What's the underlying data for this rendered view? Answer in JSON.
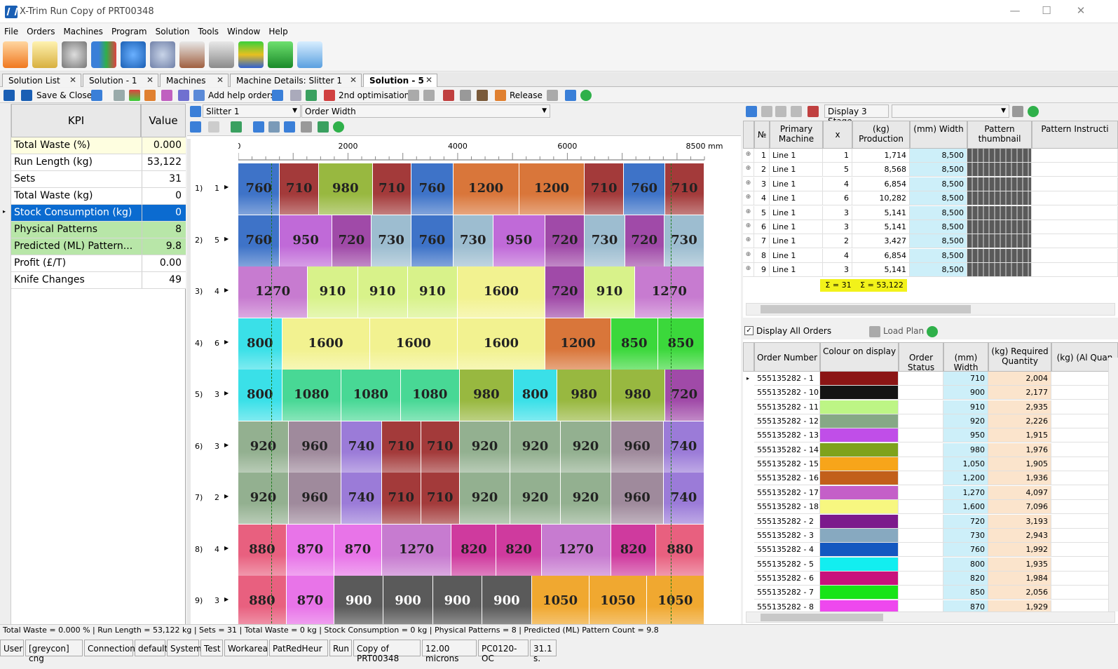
{
  "window": {
    "title": "X-Trim Run Copy of PRT00348"
  },
  "menu": [
    "File",
    "Orders",
    "Machines",
    "Program",
    "Solution",
    "Tools",
    "Window",
    "Help"
  ],
  "tabs": [
    "Solution List",
    "Solution - 1",
    "Machines",
    "Machine Details: Slitter 1",
    "Solution - 5"
  ],
  "toolbar": {
    "save_close": "Save & Close",
    "add_help": "Add help orders",
    "second_opt": "2nd optimisation",
    "release": "Release"
  },
  "kpi": {
    "header_kpi": "KPI",
    "header_value": "Value",
    "rows": [
      {
        "name": "Total Waste (%)",
        "value": "0.000",
        "bg": "#fefee0"
      },
      {
        "name": "Run Length (kg)",
        "value": "53,122",
        "bg": "#ffffff"
      },
      {
        "name": "Sets",
        "value": "31",
        "bg": "#ffffff"
      },
      {
        "name": "Total Waste (kg)",
        "value": "0",
        "bg": "#ffffff"
      },
      {
        "name": "Stock Consumption (kg)",
        "value": "0",
        "bg": "#0b6bd0"
      },
      {
        "name": "Physical Patterns",
        "value": "8",
        "bg": "#b8e6a8"
      },
      {
        "name": "Predicted (ML) Pattern...",
        "value": "9.8",
        "bg": "#b8e6a8"
      },
      {
        "name": "Profit (£/T)",
        "value": "0.00",
        "bg": "#ffffff"
      },
      {
        "name": "Knife Changes",
        "value": "49",
        "bg": "#ffffff"
      }
    ]
  },
  "center": {
    "machine": "Slitter 1",
    "sort": "Order Width",
    "ruler_ticks": [
      "0",
      "2000",
      "4000",
      "6000",
      "8500 mm"
    ],
    "patterns": [
      {
        "no": "1)",
        "sets": "1",
        "widths": [
          "760",
          "710",
          "980",
          "710",
          "760",
          "1200",
          "1200",
          "710",
          "760",
          "710"
        ]
      },
      {
        "no": "2)",
        "sets": "5",
        "widths": [
          "760",
          "950",
          "720",
          "730",
          "760",
          "730",
          "950",
          "720",
          "730",
          "720",
          "730"
        ]
      },
      {
        "no": "3)",
        "sets": "4",
        "widths": [
          "1270",
          "910",
          "910",
          "910",
          "1600",
          "720",
          "910",
          "1270"
        ]
      },
      {
        "no": "4)",
        "sets": "6",
        "widths": [
          "800",
          "1600",
          "1600",
          "1600",
          "1200",
          "850",
          "850"
        ]
      },
      {
        "no": "5)",
        "sets": "3",
        "widths": [
          "800",
          "1080",
          "1080",
          "1080",
          "980",
          "800",
          "980",
          "980",
          "720"
        ]
      },
      {
        "no": "6)",
        "sets": "3",
        "widths": [
          "920",
          "960",
          "740",
          "710",
          "710",
          "920",
          "920",
          "920",
          "960",
          "740"
        ]
      },
      {
        "no": "7)",
        "sets": "2",
        "widths": [
          "920",
          "960",
          "740",
          "710",
          "710",
          "920",
          "920",
          "920",
          "960",
          "740"
        ]
      },
      {
        "no": "8)",
        "sets": "4",
        "widths": [
          "880",
          "870",
          "870",
          "1270",
          "820",
          "820",
          "1270",
          "820",
          "880"
        ]
      },
      {
        "no": "9)",
        "sets": "3",
        "widths": [
          "880",
          "870",
          "900",
          "900",
          "900",
          "900",
          "1050",
          "1050",
          "1050"
        ]
      }
    ]
  },
  "colors": {
    "710": "#a33a3a",
    "720": "#a04aa8",
    "730": "#9dbdd0",
    "740": "#9b7bd8",
    "760": "#3e73c8",
    "800": "#3ae0e8",
    "820": "#cf3a9e",
    "850": "#3bd83b",
    "870": "#e874e8",
    "880": "#e8607f",
    "900": "#5a5a5a",
    "910": "#d8f28a",
    "920": "#93b090",
    "950": "#c06ad8",
    "960": "#9f8a9c",
    "980": "#98b840",
    "1050": "#f0a830",
    "1080": "#48d895",
    "1200": "#d9763a",
    "1270": "#c77bd0",
    "1600": "#f2f290"
  },
  "primary_grid": {
    "display_btn": "Display 3 Stage",
    "headers": [
      "№",
      "Primary Machine",
      "x",
      "(kg) Production",
      "(mm) Width",
      "Pattern thumbnail",
      "Pattern Instructi"
    ],
    "rows": [
      [
        "1",
        "Line 1",
        "1",
        "1,714",
        "8,500"
      ],
      [
        "2",
        "Line 1",
        "5",
        "8,568",
        "8,500"
      ],
      [
        "3",
        "Line 1",
        "4",
        "6,854",
        "8,500"
      ],
      [
        "4",
        "Line 1",
        "6",
        "10,282",
        "8,500"
      ],
      [
        "5",
        "Line 1",
        "3",
        "5,141",
        "8,500"
      ],
      [
        "6",
        "Line 1",
        "3",
        "5,141",
        "8,500"
      ],
      [
        "7",
        "Line 1",
        "2",
        "3,427",
        "8,500"
      ],
      [
        "8",
        "Line 1",
        "4",
        "6,854",
        "8,500"
      ],
      [
        "9",
        "Line 1",
        "3",
        "5,141",
        "8,500"
      ]
    ],
    "sum_sets": "Σ = 31",
    "sum_prod": "Σ = 53,122"
  },
  "orders": {
    "display_all": "Display All Orders",
    "load_plan": "Load Plan",
    "headers": [
      "Order Number",
      "Colour on display",
      "Order Status",
      "(mm) Width",
      "(kg) Required Quantity",
      "(kg) (Al Quan"
    ],
    "rows": [
      {
        "num": "555135282 - 1",
        "color": "#8b1515",
        "width": "710",
        "qty": "2,004"
      },
      {
        "num": "555135282 - 10",
        "color": "#141414",
        "width": "900",
        "qty": "2,177"
      },
      {
        "num": "555135282 - 11",
        "color": "#bdf585",
        "width": "910",
        "qty": "2,935"
      },
      {
        "num": "555135282 - 12",
        "color": "#86a886",
        "width": "920",
        "qty": "2,226"
      },
      {
        "num": "555135282 - 13",
        "color": "#c04ee8",
        "width": "950",
        "qty": "1,915"
      },
      {
        "num": "555135282 - 14",
        "color": "#7ea21c",
        "width": "980",
        "qty": "1,976"
      },
      {
        "num": "555135282 - 15",
        "color": "#f7a51a",
        "width": "1,050",
        "qty": "1,905"
      },
      {
        "num": "555135282 - 16",
        "color": "#c25f1a",
        "width": "1,200",
        "qty": "1,936"
      },
      {
        "num": "555135282 - 17",
        "color": "#c45fc8",
        "width": "1,270",
        "qty": "4,097"
      },
      {
        "num": "555135282 - 18",
        "color": "#f7f780",
        "width": "1,600",
        "qty": "7,096"
      },
      {
        "num": "555135282 - 2",
        "color": "#7c1a8c",
        "width": "720",
        "qty": "3,193"
      },
      {
        "num": "555135282 - 3",
        "color": "#87a9c0",
        "width": "730",
        "qty": "2,943"
      },
      {
        "num": "555135282 - 4",
        "color": "#1458c0",
        "width": "760",
        "qty": "1,992"
      },
      {
        "num": "555135282 - 5",
        "color": "#12eef0",
        "width": "800",
        "qty": "1,935"
      },
      {
        "num": "555135282 - 6",
        "color": "#c8127c",
        "width": "820",
        "qty": "1,984"
      },
      {
        "num": "555135282 - 7",
        "color": "#17e417",
        "width": "850",
        "qty": "2,056"
      },
      {
        "num": "555135282 - 8",
        "color": "#ee48ee",
        "width": "870",
        "qty": "1,929"
      }
    ]
  },
  "status": "Total Waste = 0.000 % | Run Length = 53,122 kg | Sets = 31 | Total Waste = 0 kg | Stock Consumption = 0 kg | Physical Patterns = 8 | Predicted (ML) Pattern Count = 9.8",
  "bottom": [
    "User",
    "[greycon] cng",
    "Connection",
    "default",
    "System",
    "Test",
    "Workarea",
    "PatRedHeur",
    "Run",
    "Copy of PRT00348",
    "12.00 microns",
    "PC0120-OC",
    "31.1 s."
  ]
}
